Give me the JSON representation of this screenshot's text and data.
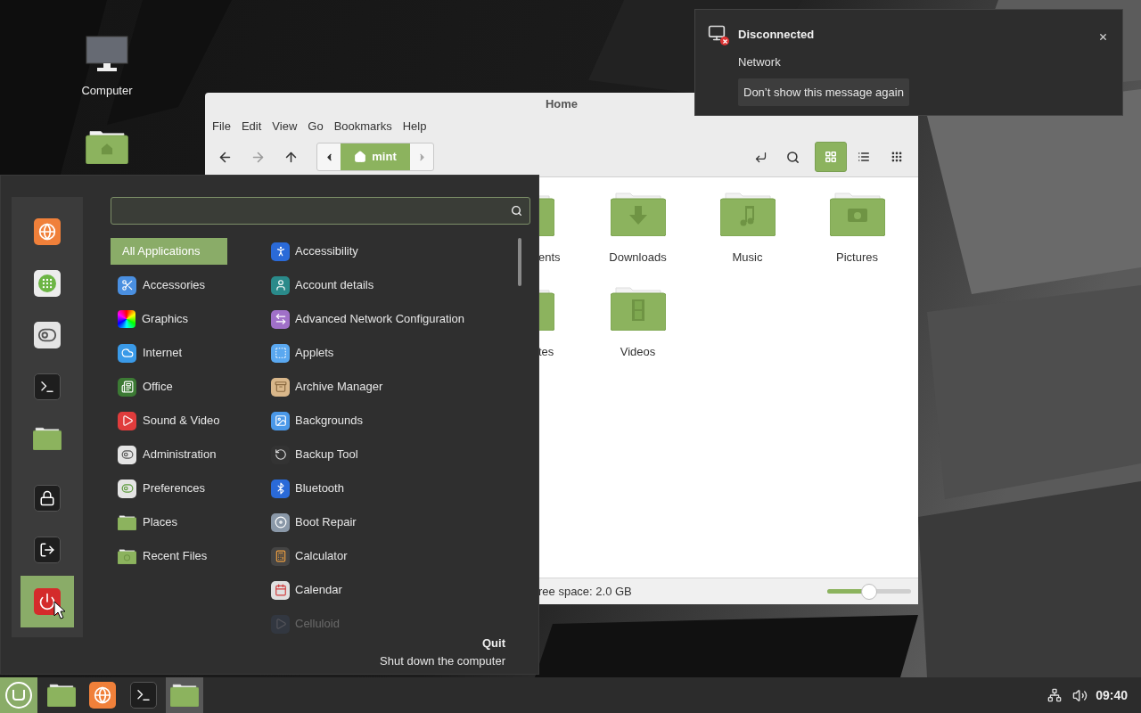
{
  "desktop_icons": [
    {
      "kind": "computer",
      "label": "Computer"
    },
    {
      "kind": "home"
    }
  ],
  "file_manager": {
    "title": "Home",
    "menu": [
      "File",
      "Edit",
      "View",
      "Go",
      "Bookmarks",
      "Help"
    ],
    "nav": [
      {
        "kind": "back",
        "disabled": false
      },
      {
        "kind": "forward",
        "disabled": true
      },
      {
        "kind": "up",
        "disabled": false
      }
    ],
    "path": "mint",
    "view_modes": [
      {
        "kind": "icons",
        "selected": true
      },
      {
        "kind": "list",
        "selected": false
      },
      {
        "kind": "compact",
        "selected": false
      }
    ],
    "folder_rows": [
      [
        {
          "label": "ents",
          "partial": true
        },
        {
          "kind": "download",
          "label": "Downloads",
          "partial": false
        },
        {
          "kind": "music",
          "label": "Music",
          "partial": false
        },
        {
          "kind": "camera",
          "label": "Pictures",
          "partial": false
        }
      ],
      [
        {
          "label": "tes",
          "partial": true
        },
        {
          "kind": "film",
          "label": "Videos",
          "partial": false
        }
      ]
    ],
    "status": "ree space: 2.0 GB",
    "zoom": {
      "level": 0.5
    }
  },
  "menu": {
    "favorites": [
      {
        "kind": "browser",
        "selected": false
      },
      {
        "kind": "software",
        "selected": false
      },
      {
        "kind": "settings",
        "selected": false
      },
      {
        "kind": "terminal",
        "selected": false
      },
      {
        "kind": "folder",
        "selected": false
      },
      {
        "kind": "lock",
        "selected": false
      },
      {
        "kind": "logout",
        "selected": false
      },
      {
        "kind": "power",
        "selected": true
      }
    ],
    "categories": [
      {
        "kind": "all",
        "label": "All Applications",
        "selected": true
      },
      {
        "kind": "accessories",
        "label": "Accessories",
        "selected": false
      },
      {
        "kind": "graphics",
        "label": "Graphics",
        "selected": false
      },
      {
        "kind": "internet",
        "label": "Internet",
        "selected": false
      },
      {
        "kind": "office",
        "label": "Office",
        "selected": false
      },
      {
        "kind": "sound",
        "label": "Sound & Video",
        "selected": false
      },
      {
        "kind": "administration",
        "label": "Administration",
        "selected": false
      },
      {
        "kind": "preferences",
        "label": "Preferences",
        "selected": false
      },
      {
        "kind": "places",
        "label": "Places",
        "selected": false
      },
      {
        "kind": "recent",
        "label": "Recent Files",
        "selected": false
      }
    ],
    "apps": [
      {
        "kind": "accessibility",
        "label": "Accessibility",
        "dimmed": false
      },
      {
        "kind": "account",
        "label": "Account details",
        "dimmed": false
      },
      {
        "kind": "network",
        "label": "Advanced Network Configuration",
        "dimmed": false
      },
      {
        "kind": "applets",
        "label": "Applets",
        "dimmed": false
      },
      {
        "kind": "archive",
        "label": "Archive Manager",
        "dimmed": false
      },
      {
        "kind": "backgrounds",
        "label": "Backgrounds",
        "dimmed": false
      },
      {
        "kind": "backup",
        "label": "Backup Tool",
        "dimmed": false
      },
      {
        "kind": "bluetooth",
        "label": "Bluetooth",
        "dimmed": false
      },
      {
        "kind": "bootrepair",
        "label": "Boot Repair",
        "dimmed": false
      },
      {
        "kind": "calculator",
        "label": "Calculator",
        "dimmed": false
      },
      {
        "kind": "calendar",
        "label": "Calendar",
        "dimmed": false
      },
      {
        "kind": "video",
        "label": "Celluloid",
        "dimmed": true
      }
    ],
    "quit": {
      "title": "Quit",
      "description": "Shut down the computer"
    }
  },
  "notification": {
    "title": "Disconnected",
    "body": "Network",
    "button": "Don’t show this message again"
  },
  "taskbar": {
    "launchers": [
      {
        "kind": "menu",
        "active": true
      },
      {
        "kind": "files",
        "active": false
      },
      {
        "kind": "browser",
        "active": false
      },
      {
        "kind": "terminal",
        "active": false
      },
      {
        "kind": "files",
        "active": true
      }
    ],
    "clock": "09:40"
  }
}
